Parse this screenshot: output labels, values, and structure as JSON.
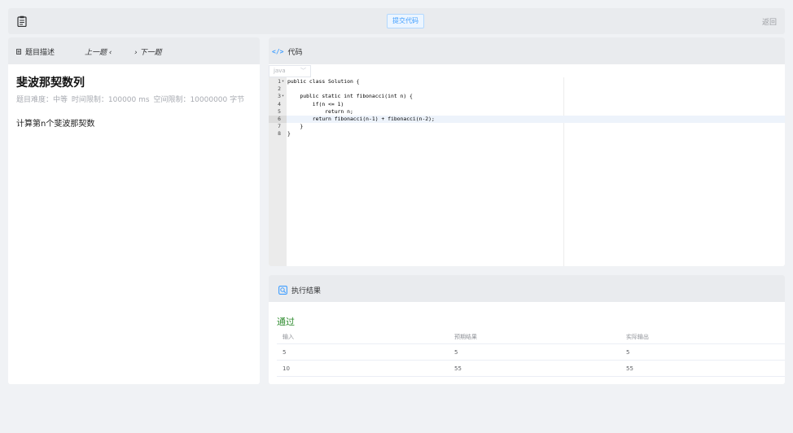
{
  "topbar": {
    "icon": "clipboard-icon",
    "submit_label": "提交代码",
    "back_label": "返回"
  },
  "problem_panel": {
    "tab_label": "题目描述",
    "prev_label": "上一题 ‹",
    "next_label": "› 下一题",
    "title": "斐波那契数列",
    "difficulty": "题目难度：中等",
    "time_limit": "时间限制：100000 ms",
    "space_limit": "空间限制：10000000 字节",
    "description": "计算第n个斐波那契数"
  },
  "code_panel": {
    "title": "代码",
    "icon": "code-icon",
    "language": "java",
    "active_line": 6,
    "lines": [
      {
        "n": "1",
        "fold": "▾",
        "code": "public class Solution {"
      },
      {
        "n": "2",
        "fold": "",
        "code": ""
      },
      {
        "n": "3",
        "fold": "▾",
        "code": "    public static int fibonacci(int n) {"
      },
      {
        "n": "4",
        "fold": "",
        "code": "        if(n <= 1)"
      },
      {
        "n": "5",
        "fold": "",
        "code": "            return n;"
      },
      {
        "n": "6",
        "fold": "",
        "code": "        return fibonacci(n-1) + fibonacci(n-2);"
      },
      {
        "n": "7",
        "fold": "",
        "code": "    }"
      },
      {
        "n": "8",
        "fold": "",
        "code": "}"
      }
    ]
  },
  "result_panel": {
    "title": "执行结果",
    "icon": "result-icon",
    "status": "通过",
    "status_color": "#2e8b2e",
    "columns": [
      "输入",
      "预期结果",
      "实际输出"
    ],
    "rows": [
      [
        "5",
        "5",
        "5"
      ],
      [
        "10",
        "55",
        "55"
      ]
    ]
  }
}
